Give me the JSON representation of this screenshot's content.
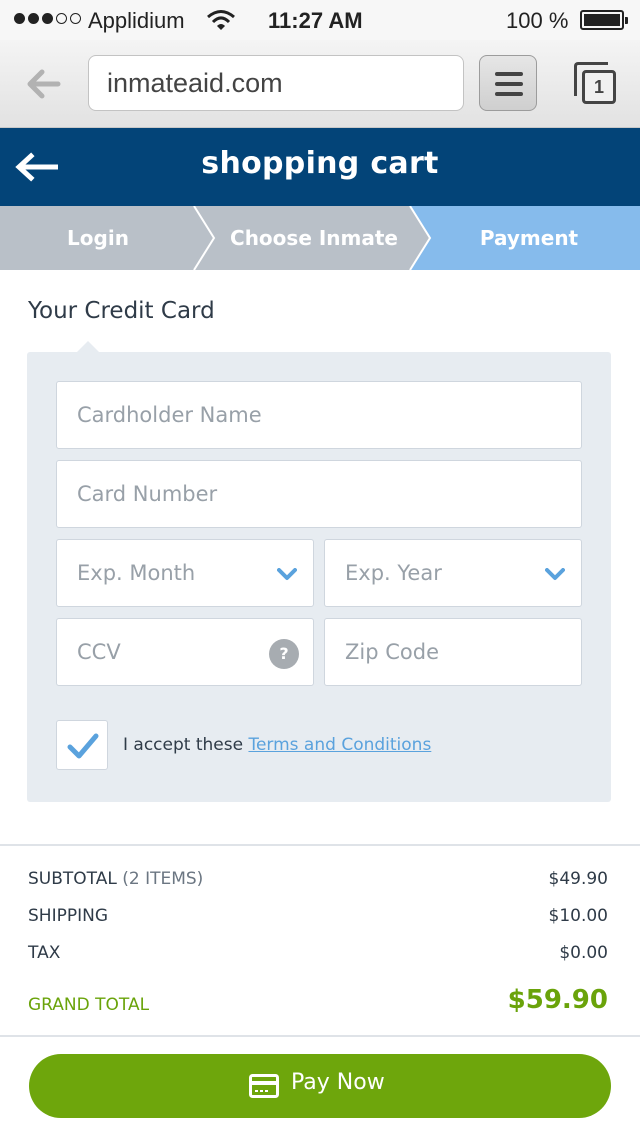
{
  "status_bar": {
    "carrier": "Applidium",
    "time": "11:27 AM",
    "battery": "100 %",
    "signal_bars": 3
  },
  "browser": {
    "url": "inmateaid.com",
    "tab_count": "1"
  },
  "header": {
    "title": "shopping cart"
  },
  "steps": [
    {
      "label": "Login",
      "state": "done"
    },
    {
      "label": "Choose Inmate",
      "state": "done"
    },
    {
      "label": "Payment",
      "state": "active"
    }
  ],
  "form": {
    "section_title": "Your Credit Card",
    "cardholder_placeholder": "Cardholder Name",
    "card_number_placeholder": "Card Number",
    "exp_month_placeholder": "Exp. Month",
    "exp_year_placeholder": "Exp. Year",
    "ccv_placeholder": "CCV",
    "ccv_help": "?",
    "zip_placeholder": "Zip Code",
    "terms_checked": true,
    "accept_text": "I accept these ",
    "terms_link": "Terms and Conditions"
  },
  "totals": {
    "subtotal_label": "SUBTOTAL",
    "subtotal_items": "(2 ITEMS)",
    "subtotal_value": "$49.90",
    "shipping_label": "SHIPPING",
    "shipping_value": "$10.00",
    "tax_label": "TAX",
    "tax_value": "$0.00",
    "grand_total_label": "GRAND TOTAL",
    "grand_total_value": "$59.90"
  },
  "pay_button": {
    "label": "Pay Now"
  },
  "colors": {
    "header_bg": "#034478",
    "step_inactive": "#b9c0c8",
    "step_active": "#86bbec",
    "accent_green": "#6ea60c",
    "link_blue": "#5aa2dd"
  }
}
